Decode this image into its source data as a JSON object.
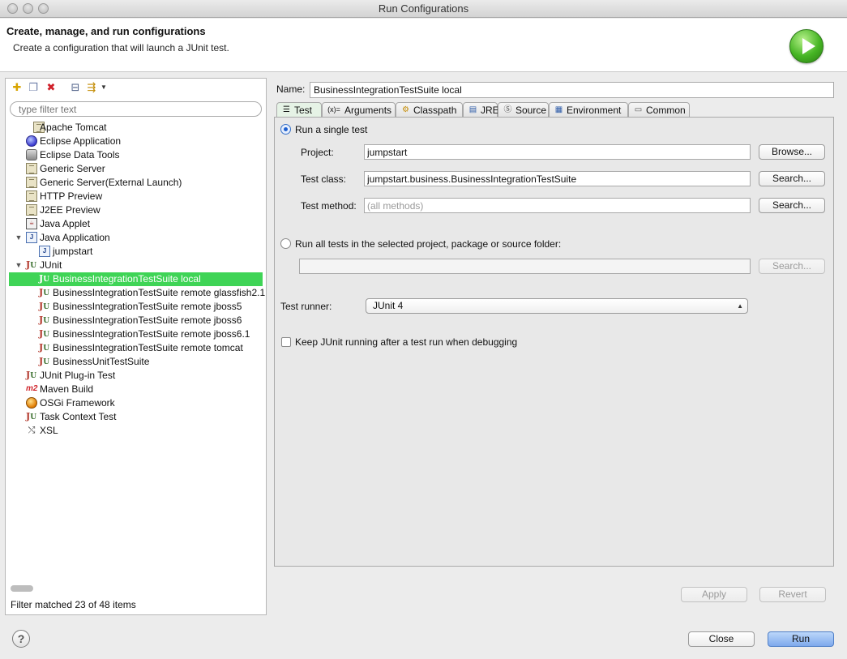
{
  "window": {
    "title": "Run Configurations"
  },
  "header": {
    "title": "Create, manage, and run configurations",
    "subtitle": "Create a configuration that will launch a JUnit test.",
    "logo_icon": "run-launch-icon"
  },
  "left": {
    "toolbar": [
      "new-config-icon",
      "duplicate-icon",
      "delete-icon",
      "collapse-all-icon",
      "filter-icon"
    ],
    "filter_placeholder": "type filter text",
    "tree": [
      {
        "label": "Apache Tomcat",
        "icon": "server-icon",
        "level": 1
      },
      {
        "label": "Eclipse Application",
        "icon": "eclipse-icon",
        "level": 1
      },
      {
        "label": "Eclipse Data Tools",
        "icon": "data-tools-icon",
        "level": 1
      },
      {
        "label": "Generic Server",
        "icon": "server-icon",
        "level": 1
      },
      {
        "label": "Generic Server(External Launch)",
        "icon": "server-icon",
        "level": 1
      },
      {
        "label": "HTTP Preview",
        "icon": "server-icon",
        "level": 1
      },
      {
        "label": "J2EE Preview",
        "icon": "server-icon",
        "level": 1
      },
      {
        "label": "Java Applet",
        "icon": "applet-icon",
        "level": 1
      },
      {
        "label": "Java Application",
        "icon": "java-app-icon",
        "level": 1,
        "expanded": true
      },
      {
        "label": "jumpstart",
        "icon": "java-app-icon",
        "level": 2
      },
      {
        "label": "JUnit",
        "icon": "junit-icon",
        "level": 1,
        "expanded": true
      },
      {
        "label": "BusinessIntegrationTestSuite local",
        "icon": "junit-icon",
        "level": 2,
        "selected": true
      },
      {
        "label": "BusinessIntegrationTestSuite remote glassfish2.1",
        "icon": "junit-icon",
        "level": 2
      },
      {
        "label": "BusinessIntegrationTestSuite remote jboss5",
        "icon": "junit-icon",
        "level": 2
      },
      {
        "label": "BusinessIntegrationTestSuite remote jboss6",
        "icon": "junit-icon",
        "level": 2
      },
      {
        "label": "BusinessIntegrationTestSuite remote jboss6.1",
        "icon": "junit-icon",
        "level": 2
      },
      {
        "label": "BusinessIntegrationTestSuite remote tomcat",
        "icon": "junit-icon",
        "level": 2
      },
      {
        "label": "BusinessUnitTestSuite",
        "icon": "junit-icon",
        "level": 2
      },
      {
        "label": "JUnit Plug-in Test",
        "icon": "junit-plugin-icon",
        "level": 1
      },
      {
        "label": "Maven Build",
        "icon": "maven-icon",
        "level": 1
      },
      {
        "label": "OSGi Framework",
        "icon": "osgi-icon",
        "level": 1
      },
      {
        "label": "Task Context Test",
        "icon": "task-context-icon",
        "level": 1
      },
      {
        "label": "XSL",
        "icon": "xsl-icon",
        "level": 1
      }
    ],
    "status": "Filter matched 23 of 48 items"
  },
  "right": {
    "name_label": "Name:",
    "name_value": "BusinessIntegrationTestSuite local",
    "tabs": [
      {
        "label": "Test",
        "icon": "test-tab-icon",
        "active": true
      },
      {
        "label": "Arguments",
        "icon": "arguments-icon"
      },
      {
        "label": "Classpath",
        "icon": "classpath-icon"
      },
      {
        "label": "JRE",
        "icon": "jre-icon"
      },
      {
        "label": "Source",
        "icon": "source-icon"
      },
      {
        "label": "Environment",
        "icon": "environment-icon"
      },
      {
        "label": "Common",
        "icon": "common-icon"
      }
    ],
    "tab_icon_glyphs": [
      "☰",
      "(x)=",
      "⚙",
      "▤",
      "Ⓢ",
      "▦",
      "▭"
    ],
    "single_test": {
      "label": "Run a single test",
      "project_label": "Project:",
      "project_value": "jumpstart",
      "browse": "Browse...",
      "class_label": "Test class:",
      "class_value": "jumpstart.business.BusinessIntegrationTestSuite",
      "search_class": "Search...",
      "method_label": "Test method:",
      "method_placeholder": "(all methods)",
      "search_method": "Search..."
    },
    "all_tests": {
      "label": "Run all tests in the selected project, package or source folder:",
      "value": "",
      "search": "Search..."
    },
    "runner": {
      "label": "Test runner:",
      "value": "JUnit 4"
    },
    "keep_running": {
      "label": "Keep JUnit running after a test run when debugging",
      "checked": false
    },
    "apply": "Apply",
    "revert": "Revert"
  },
  "footer": {
    "help_icon": "help-icon",
    "close": "Close",
    "run": "Run"
  }
}
